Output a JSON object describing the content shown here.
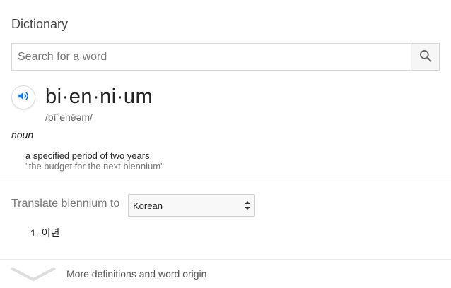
{
  "dictionary": {
    "title": "Dictionary",
    "search": {
      "placeholder": "Search for a word",
      "value": ""
    },
    "icons": {
      "search": "search-icon",
      "audio": "speaker-icon",
      "more": "chevron-down-icon"
    },
    "entry": {
      "word": "bi·en·ni·um",
      "phonetic": "/bīˈenēəm/",
      "part_of_speech": "noun",
      "definition": "a specified period of two years.",
      "example": "\"the budget for the next biennium\""
    },
    "translate": {
      "label": "Translate biennium to",
      "selected_language": "Korean",
      "results": [
        "1. 이년"
      ]
    },
    "more_label": "More definitions and word origin",
    "colors": {
      "accent": "#1a73e8",
      "muted_text": "#777777",
      "border": "#d6d6d6"
    }
  }
}
